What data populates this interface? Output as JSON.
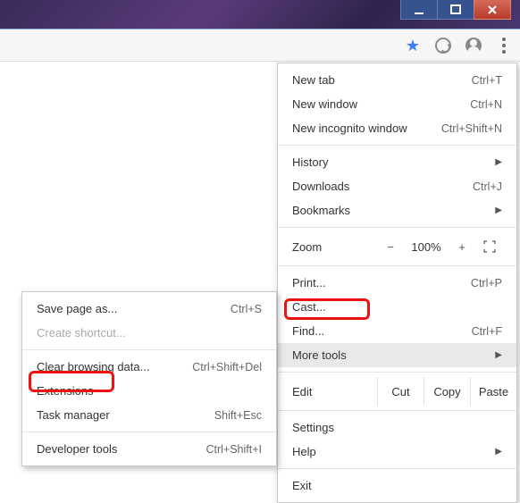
{
  "window_controls": {
    "minimize": "minimize",
    "maximize": "maximize",
    "close": "close"
  },
  "toolbar": {
    "bookmark_icon": "star-icon",
    "extension_icon": "swirl-icon",
    "profile_icon": "avatar-icon",
    "menu_icon": "kebab-icon"
  },
  "main_menu": {
    "new_tab": {
      "label": "New tab",
      "accel": "Ctrl+T"
    },
    "new_window": {
      "label": "New window",
      "accel": "Ctrl+N"
    },
    "new_incognito": {
      "label": "New incognito window",
      "accel": "Ctrl+Shift+N"
    },
    "history": {
      "label": "History"
    },
    "downloads": {
      "label": "Downloads",
      "accel": "Ctrl+J"
    },
    "bookmarks": {
      "label": "Bookmarks"
    },
    "zoom": {
      "label": "Zoom",
      "minus": "−",
      "value": "100%",
      "plus": "+"
    },
    "print": {
      "label": "Print...",
      "accel": "Ctrl+P"
    },
    "cast": {
      "label": "Cast..."
    },
    "find": {
      "label": "Find...",
      "accel": "Ctrl+F"
    },
    "more_tools": {
      "label": "More tools"
    },
    "edit": {
      "label": "Edit",
      "cut": "Cut",
      "copy": "Copy",
      "paste": "Paste"
    },
    "settings": {
      "label": "Settings"
    },
    "help": {
      "label": "Help"
    },
    "exit": {
      "label": "Exit"
    }
  },
  "sub_menu": {
    "save_page": {
      "label": "Save page as...",
      "accel": "Ctrl+S"
    },
    "create_shortcut": {
      "label": "Create shortcut..."
    },
    "clear_data": {
      "label": "Clear browsing data...",
      "accel": "Ctrl+Shift+Del"
    },
    "extensions": {
      "label": "Extensions"
    },
    "task_manager": {
      "label": "Task manager",
      "accel": "Shift+Esc"
    },
    "dev_tools": {
      "label": "Developer tools",
      "accel": "Ctrl+Shift+I"
    }
  }
}
